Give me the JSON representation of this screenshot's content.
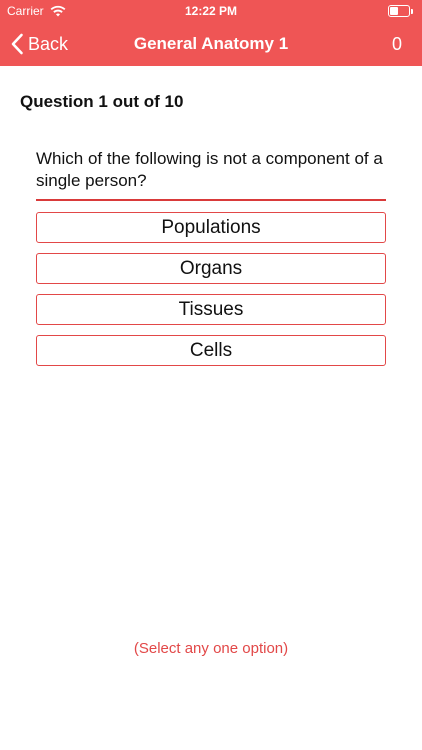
{
  "status_bar": {
    "carrier": "Carrier",
    "time": "12:22 PM",
    "battery_level_percent": 45
  },
  "nav": {
    "back_label": "Back",
    "title": "General Anatomy 1",
    "score": "0"
  },
  "quiz": {
    "counter": "Question 1 out of 10",
    "question": "Which of the following is not a component of a single person?",
    "options": [
      "Populations",
      "Organs",
      "Tissues",
      "Cells"
    ],
    "hint": "(Select any one option)"
  },
  "colors": {
    "accent": "#ef5555",
    "border": "#e24848",
    "text": "#111111"
  },
  "icons": {
    "wifi": "wifi-icon",
    "battery": "battery-icon",
    "back": "chevron-left-icon"
  }
}
